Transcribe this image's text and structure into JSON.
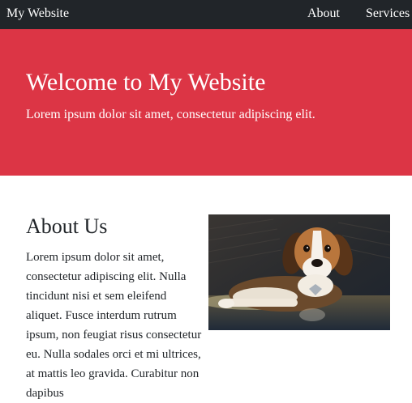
{
  "navbar": {
    "brand": "My Website",
    "links": [
      "About",
      "Services"
    ],
    "background": "#212529"
  },
  "hero": {
    "title": "Welcome to My Website",
    "subtitle": "Lorem ipsum dolor sit amet, consectetur adipiscing elit.",
    "background": "#dc3545"
  },
  "about": {
    "heading": "About Us",
    "body": "Lorem ipsum dolor sit amet, consectetur adipiscing elit. Nulla tincidunt nisi et sem eleifend aliquet. Fusce interdum rutrum ipsum, non feugiat risus consectetur eu. Nulla sodales orci et mi ultrices, at mattis leo gravida. Curabitur non dapibus",
    "image": "beagle-dog-photo"
  }
}
